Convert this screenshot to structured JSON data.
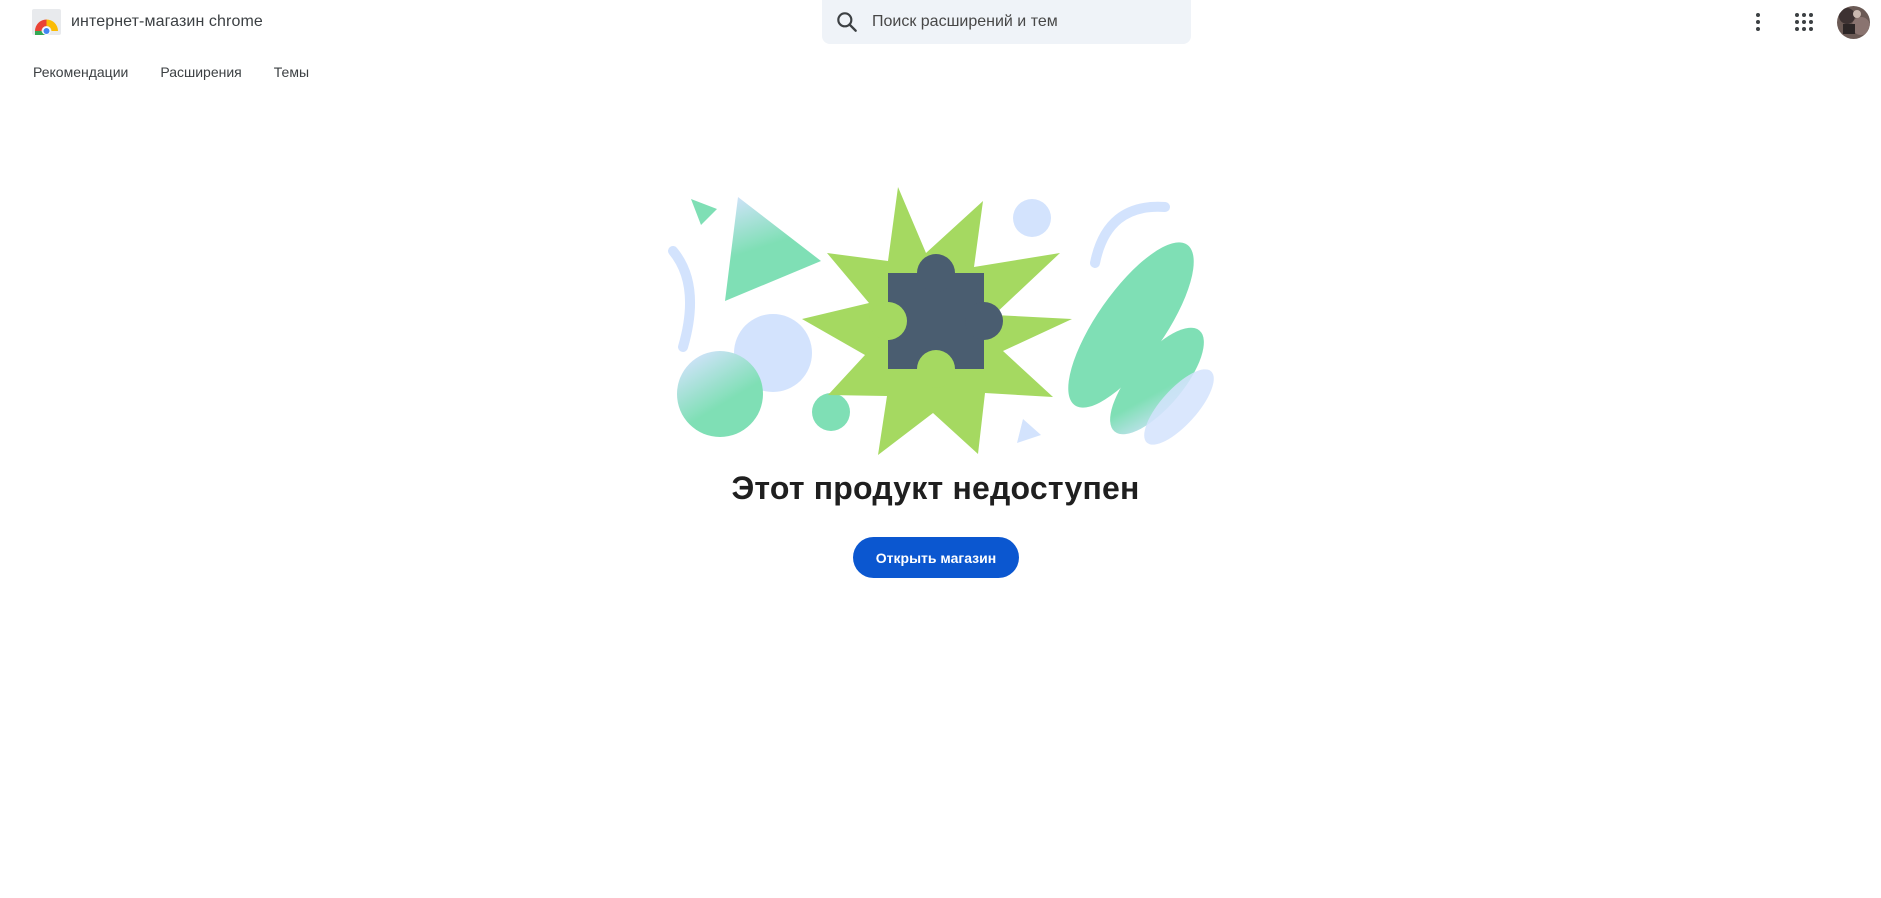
{
  "header": {
    "logo_text": "интернет-магазин chrome",
    "search_placeholder": "Поиск расширений и тем",
    "search_value": ""
  },
  "nav": {
    "items": [
      {
        "label": "Рекомендации"
      },
      {
        "label": "Расширения"
      },
      {
        "label": "Темы"
      }
    ]
  },
  "main": {
    "message": "Этот продукт недоступен",
    "open_store_label": "Открыть магазин"
  },
  "colors": {
    "accent": "#0b57d0",
    "search_bg": "#eff3f8",
    "star_green": "#a5d961",
    "mint": "#7fdfb5",
    "light_blue": "#d3e3fd",
    "puzzle": "#4a5d70"
  },
  "icons": {
    "logo": "chrome-web-store-icon",
    "search": "search-icon",
    "more": "more-vert-icon",
    "apps": "apps-grid-icon",
    "avatar": "user-avatar",
    "illustration": "puzzle-piece-illustration"
  }
}
